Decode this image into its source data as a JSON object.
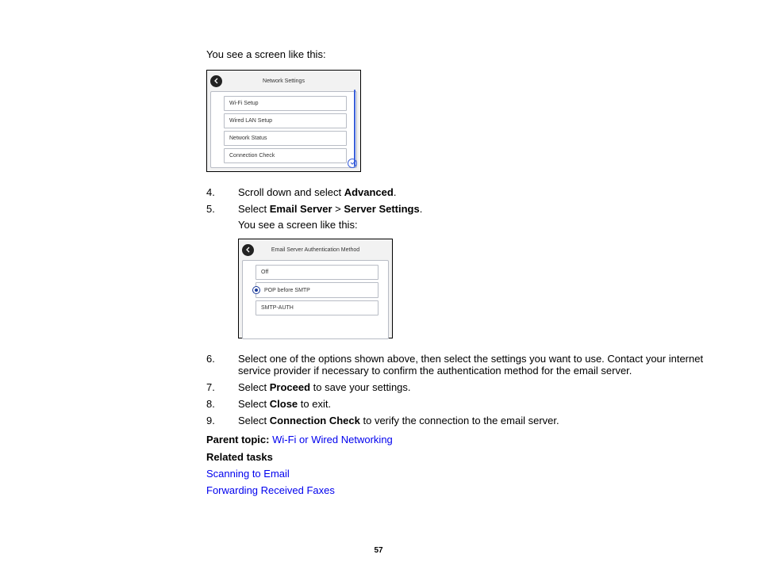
{
  "intro": "You see a screen like this:",
  "screenshot1": {
    "title": "Network Settings",
    "items": [
      "Wi-Fi Setup",
      "Wired LAN Setup",
      "Network Status",
      "Connection Check"
    ]
  },
  "steps_a": {
    "s4_pre": "Scroll down and select ",
    "s4_bold": "Advanced",
    "s4_post": ".",
    "s5_pre": "Select ",
    "s5_b1": "Email Server",
    "s5_mid": " > ",
    "s5_b2": "Server Settings",
    "s5_post": ".",
    "s5_sub": "You see a screen like this:"
  },
  "screenshot2": {
    "title": "Email Server Authentication Method",
    "items": [
      "Off",
      "POP before SMTP",
      "SMTP-AUTH"
    ]
  },
  "steps_b": {
    "s6": "Select one of the options shown above, then select the settings you want to use. Contact your internet service provider if necessary to confirm the authentication method for the email server.",
    "s7_pre": "Select ",
    "s7_bold": "Proceed",
    "s7_post": " to save your settings.",
    "s8_pre": "Select ",
    "s8_bold": "Close",
    "s8_post": " to exit.",
    "s9_pre": "Select ",
    "s9_bold": "Connection Check",
    "s9_post": " to verify the connection to the email server."
  },
  "parent_label": "Parent topic:",
  "parent_link": "Wi-Fi or Wired Networking",
  "related_label": "Related tasks",
  "related_links": [
    "Scanning to Email",
    "Forwarding Received Faxes"
  ],
  "page_number": "57"
}
